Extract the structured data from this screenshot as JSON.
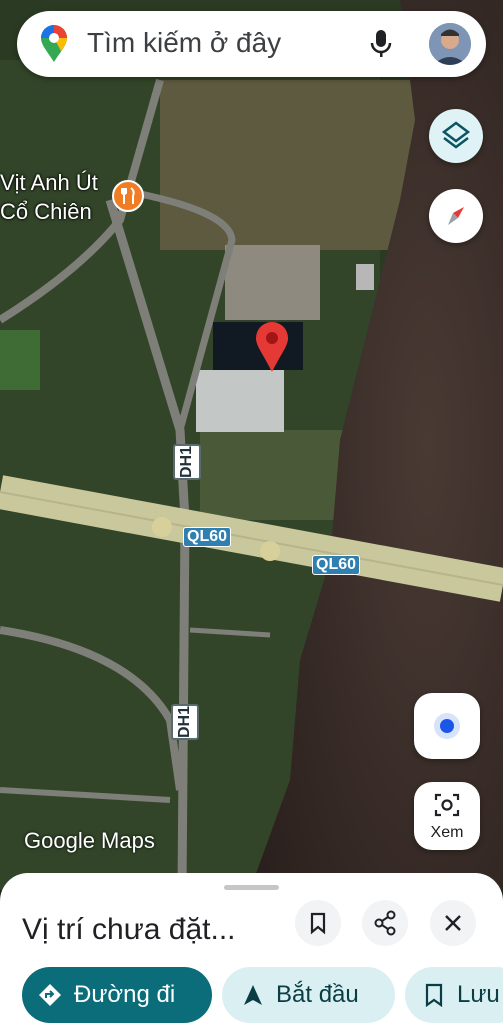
{
  "search": {
    "placeholder": "Tìm kiếm ở đây"
  },
  "map": {
    "poi": {
      "line1": "Vịt Anh Út",
      "line2": "Cổ Chiên"
    },
    "road_labels": {
      "dh1_upper": "DH1",
      "dh1_lower": "DH1",
      "ql60_left": "QL60",
      "ql60_right": "QL60"
    },
    "watermark": "Google Maps"
  },
  "controls": {
    "lens_label": "Xem"
  },
  "sheet": {
    "title": "Vị trí chưa đặt...",
    "actions": {
      "directions": "Đường đi",
      "start": "Bắt đầu",
      "save": "Lưu"
    }
  },
  "colors": {
    "accent": "#0b6c7a",
    "pin": "#e53935",
    "ql_route": "#2f7fb0"
  },
  "icons": [
    "google-maps-pin-icon",
    "mic-icon",
    "layers-icon",
    "compass-icon",
    "my-location-icon",
    "lens-icon",
    "bookmark-icon",
    "share-icon",
    "close-icon",
    "directions-icon",
    "navigation-arrow-icon",
    "bookmark-outline-icon"
  ]
}
